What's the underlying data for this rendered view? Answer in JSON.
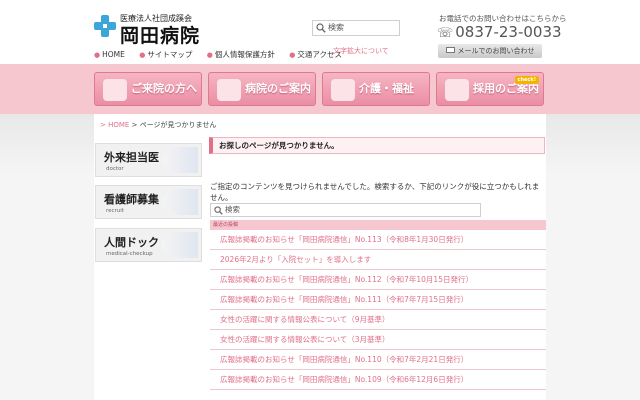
{
  "header": {
    "logo_subtitle": "医療法人社団成蹊会",
    "logo_title": "岡田病院",
    "nav": [
      {
        "label": "HOME"
      },
      {
        "label": "サイトマップ"
      },
      {
        "label": "個人情報保護方針"
      },
      {
        "label": "交通アクセス"
      }
    ],
    "search_placeholder": "検索",
    "font_size_link": "文字拡大について",
    "tel_label": "お電話でのお問い合わせはこちらから",
    "tel_number": "0837-23-0033",
    "mail_button": "メールでのお問い合わせ"
  },
  "main_nav": [
    {
      "label": "ご来院の方へ"
    },
    {
      "label": "病院のご案内"
    },
    {
      "label": "介護・福祉"
    },
    {
      "label": "採用のご案内",
      "badge": "check!"
    }
  ],
  "breadcrumb": {
    "home": "HOME",
    "separator": ">",
    "current": "ページが見つかりません"
  },
  "sidebar": [
    {
      "title": "外来担当医",
      "sub": "doctor"
    },
    {
      "title": "看護師募集",
      "sub": "recruit"
    },
    {
      "title": "人間ドック",
      "sub": "medical-checkup"
    }
  ],
  "main": {
    "heading": "お探しのページが見つかりません。",
    "message": "ご指定のコンテンツを見つけられませんでした。検索するか、下記のリンクが役に立つかもしれません。",
    "search_placeholder": "検索",
    "recent_heading": "最近の投稿",
    "posts": [
      {
        "title": "広報誌掲載のお知らせ「岡田病院通信」No.113（令和8年1月30日発行）"
      },
      {
        "title": "2026年2月より「入院セット」を導入します"
      },
      {
        "title": "広報誌掲載のお知らせ「岡田病院通信」No.112（令和7年10月15日発行）"
      },
      {
        "title": "広報誌掲載のお知らせ「岡田病院通信」No.111（令和7年7月15日発行）"
      },
      {
        "title": "女性の活躍に関する情報公表について（9月基準）"
      },
      {
        "title": "女性の活躍に関する情報公表について（3月基準）"
      },
      {
        "title": "広報誌掲載のお知らせ「岡田病院通信」No.110（令和7年2月21日発行）"
      },
      {
        "title": "広報誌掲載のお知らせ「岡田病院通信」No.109（令和6年12月6日発行）"
      }
    ]
  },
  "colors": {
    "accent_pink": "#e0708a",
    "band_pink": "#f7c7d0",
    "logo_blue": "#3ca6d8"
  }
}
